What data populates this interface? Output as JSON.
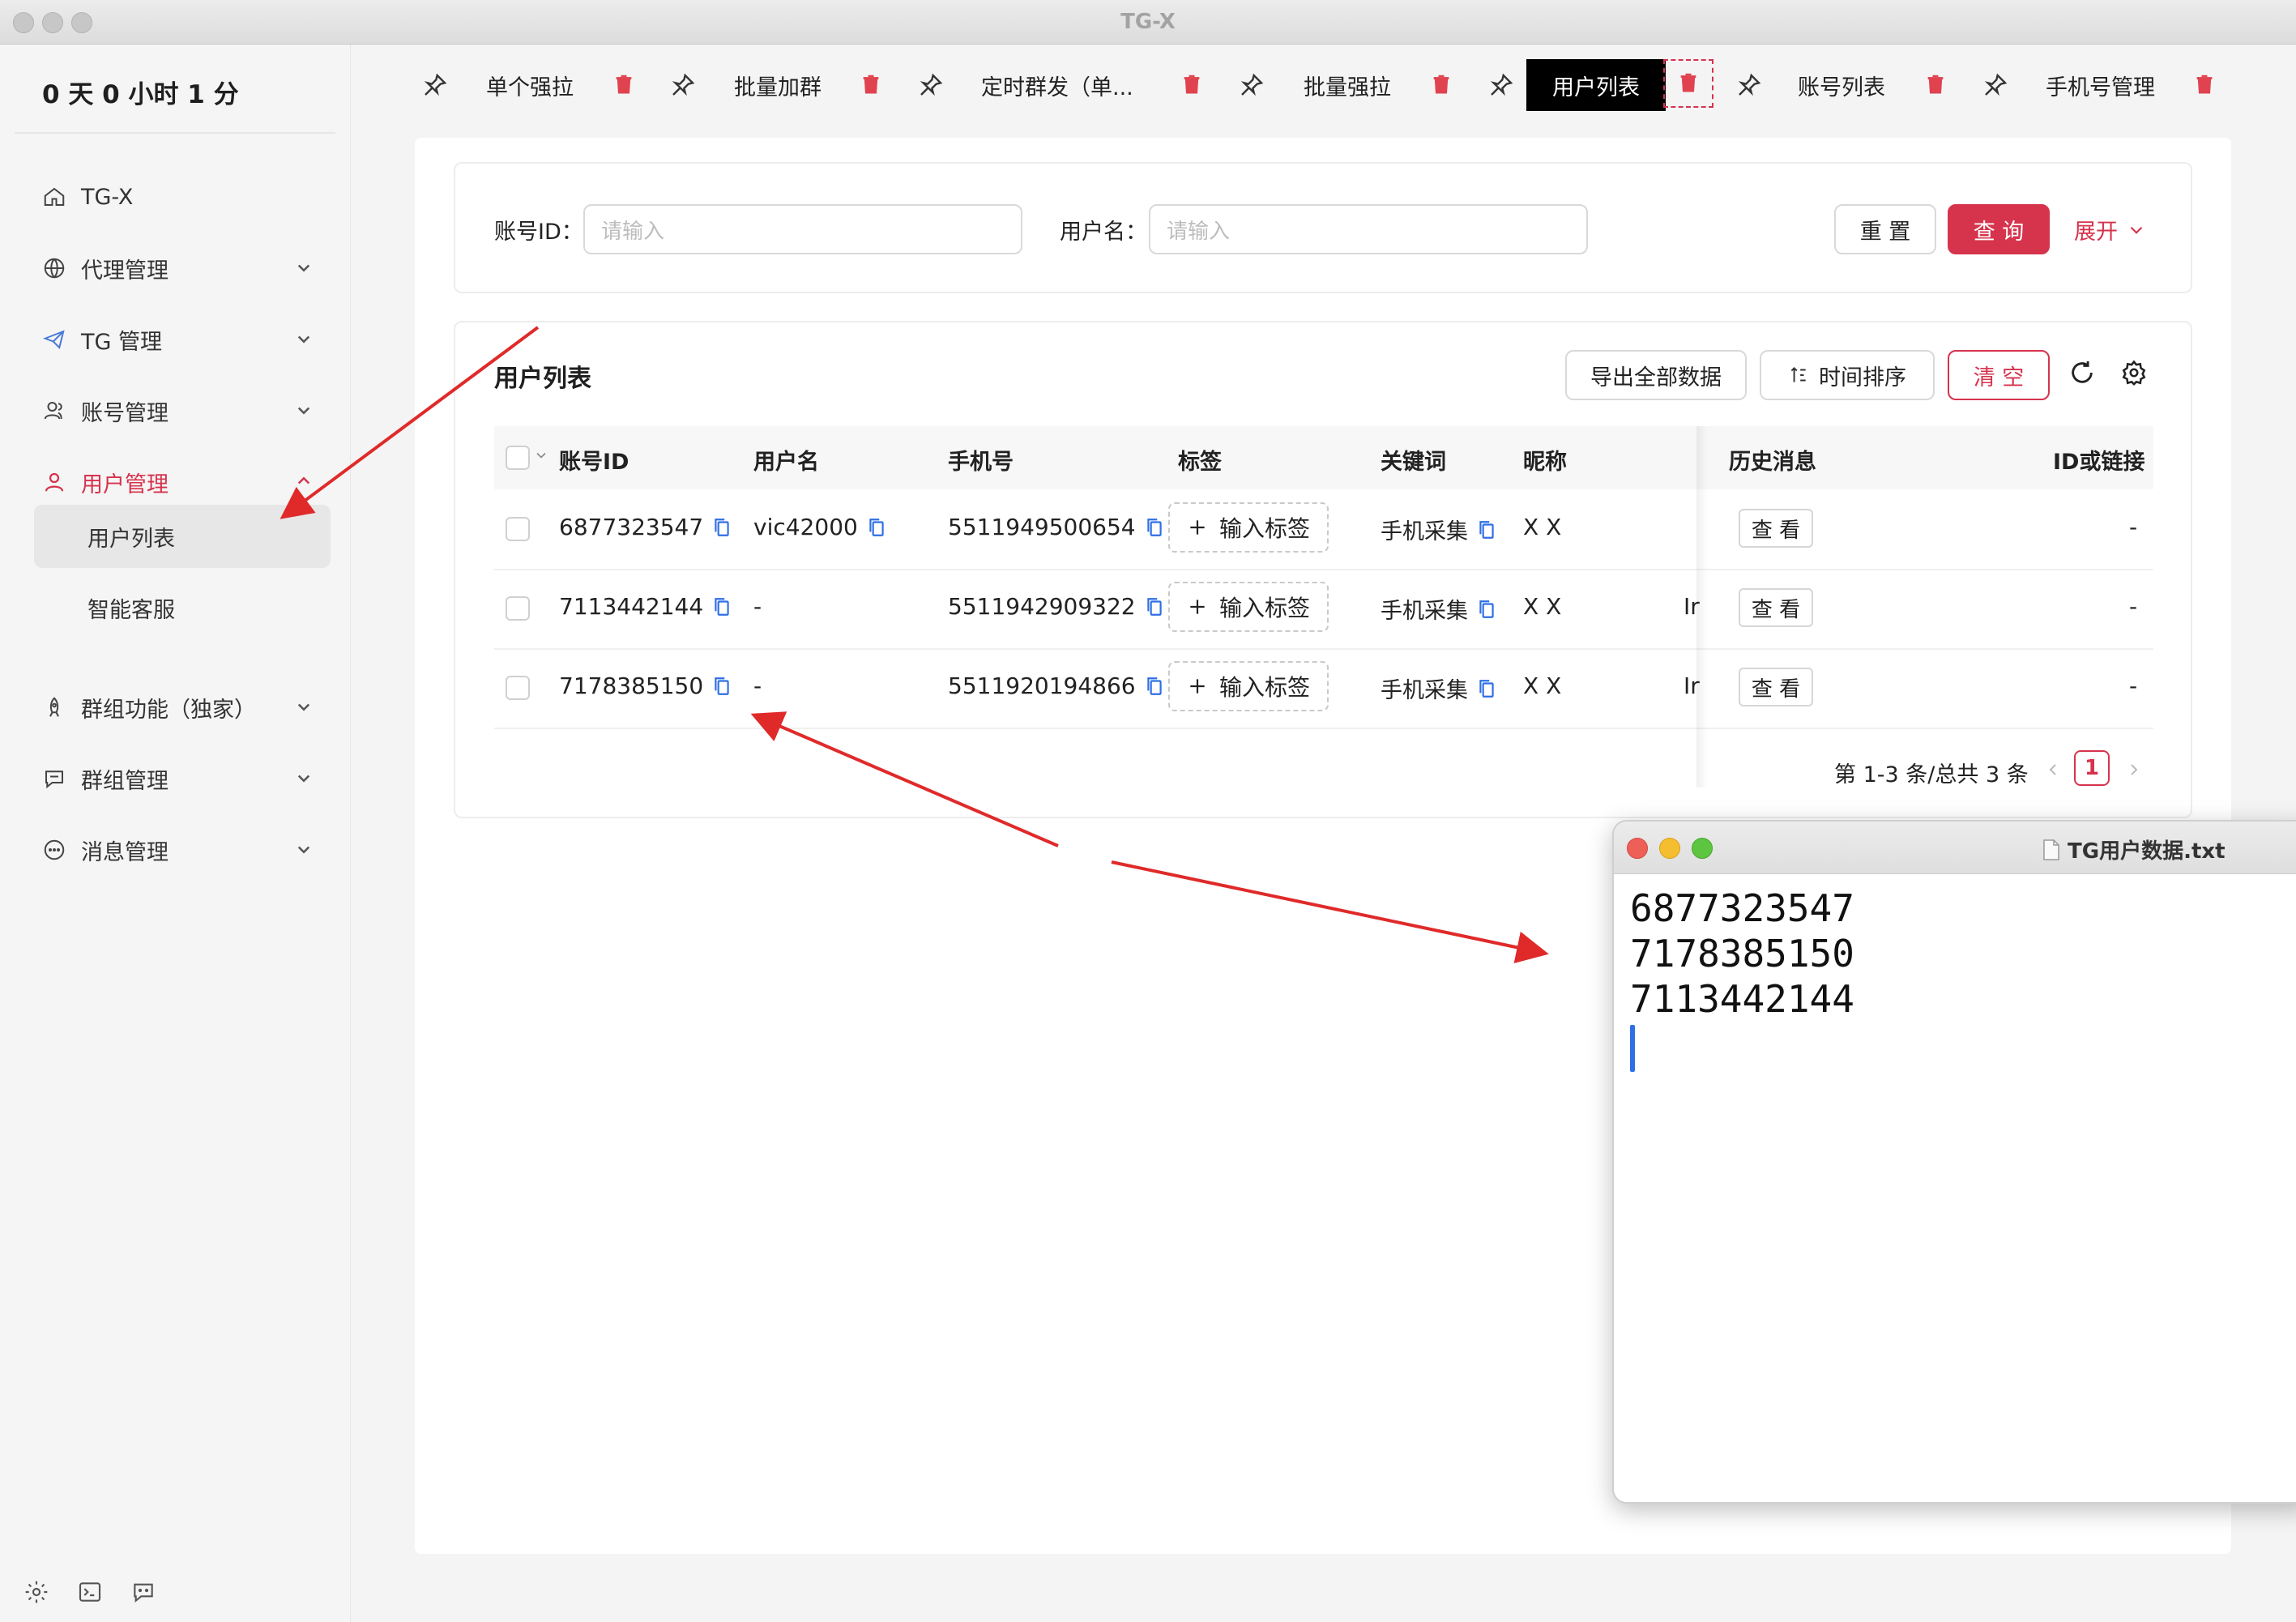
{
  "window": {
    "title": "TG-X"
  },
  "sidebar": {
    "timer": "0 天 0 小时 1 分",
    "items": [
      {
        "label": "TG-X",
        "icon": "home-icon"
      },
      {
        "label": "代理管理",
        "icon": "globe-icon"
      },
      {
        "label": "TG 管理",
        "icon": "telegram-icon"
      },
      {
        "label": "账号管理",
        "icon": "users-icon"
      },
      {
        "label": "用户管理",
        "icon": "user-icon"
      },
      {
        "label": "群组功能（独家）",
        "icon": "rocket-icon"
      },
      {
        "label": "群组管理",
        "icon": "chat-icon"
      },
      {
        "label": "消息管理",
        "icon": "message-icon"
      }
    ],
    "sub_items": [
      {
        "label": "用户列表"
      },
      {
        "label": "智能客服"
      }
    ],
    "bottom": [
      "gear-icon",
      "terminal-icon",
      "chat-bubble-icon"
    ]
  },
  "tabs": [
    {
      "label": "单个强拉"
    },
    {
      "label": "批量加群"
    },
    {
      "label": "定时群发（单..."
    },
    {
      "label": "批量强拉"
    },
    {
      "label": "用户列表"
    },
    {
      "label": "账号列表"
    },
    {
      "label": "手机号管理"
    }
  ],
  "search": {
    "account_id_label": "账号ID：",
    "account_id_placeholder": "请输入",
    "username_label": "用户名：",
    "username_placeholder": "请输入",
    "reset": "重 置",
    "query": "查 询",
    "expand": "展开"
  },
  "table": {
    "title": "用户列表",
    "export": "导出全部数据",
    "sort": "时间排序",
    "clear": "清 空",
    "columns": [
      "账号ID",
      "用户名",
      "手机号",
      "标签",
      "关键词",
      "昵称",
      "历史消息",
      "ID或链接"
    ],
    "rows": [
      {
        "account_id": "6877323547",
        "username": "vic42000",
        "phone": "5511949500654",
        "tag": "输入标签",
        "keyword": "手机采集",
        "nickname": "X X",
        "extra": "",
        "history": "查 看",
        "link": "-"
      },
      {
        "account_id": "7113442144",
        "username": "-",
        "phone": "5511942909322",
        "tag": "输入标签",
        "keyword": "手机采集",
        "nickname": "X X",
        "extra": "Ir",
        "history": "查 看",
        "link": "-"
      },
      {
        "account_id": "7178385150",
        "username": "-",
        "phone": "5511920194866",
        "tag": "输入标签",
        "keyword": "手机采集",
        "nickname": "X X",
        "extra": "Ir",
        "history": "查 看",
        "link": "-"
      }
    ],
    "pagination": {
      "summary": "第 1-3 条/总共 3 条",
      "current": "1"
    }
  },
  "text_window": {
    "title": "TG用户数据.txt",
    "lines": [
      "6877323547",
      "7178385150",
      "7113442144"
    ]
  },
  "colors": {
    "accent": "#d6334d",
    "copy_icon": "#2f6fe6",
    "arrow": "#e02a2a"
  }
}
